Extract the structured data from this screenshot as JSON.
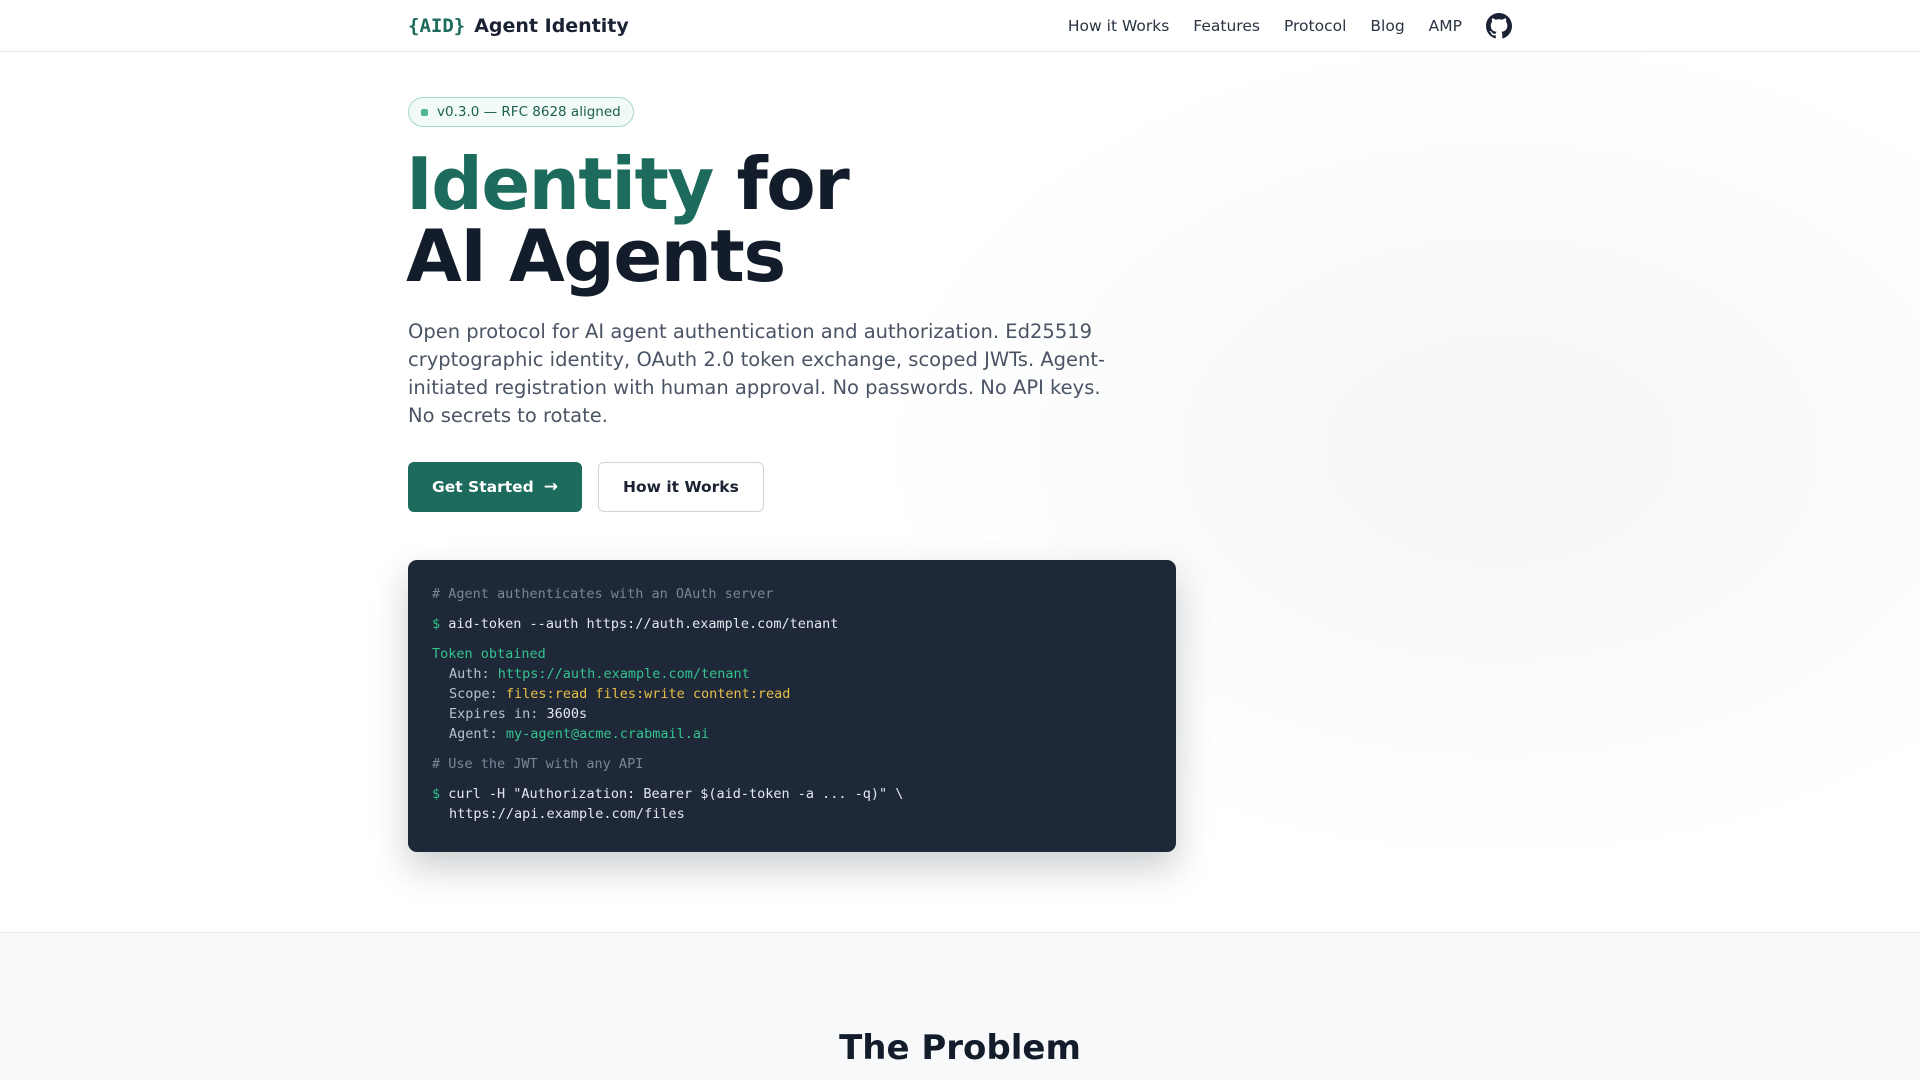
{
  "nav": {
    "brand_mark": "{AID}",
    "brand_name": "Agent Identity",
    "links": [
      "How it Works",
      "Features",
      "Protocol",
      "Blog",
      "AMP"
    ],
    "github_icon": "github-icon"
  },
  "hero": {
    "badge": "v0.3.0 — RFC 8628 aligned",
    "title_accent": "Identity",
    "title_rest_1": " for",
    "title_line_2": "AI Agents",
    "subtitle": "Open protocol for AI agent authentication and authorization. Ed25519 cryptographic identity, OAuth 2.0 token exchange, scoped JWTs. Agent-initiated registration with human approval. No passwords. No API keys. No secrets to rotate.",
    "primary_button": "Get Started",
    "primary_button_icon": "arrow-right-icon",
    "secondary_button": "How it Works"
  },
  "terminal": {
    "comment_1": "# Agent authenticates with an OAuth server",
    "prompt": "$",
    "command_1": "aid-token --auth https://auth.example.com/tenant",
    "success": "Token obtained",
    "auth_label": "Auth:",
    "auth_value": "https://auth.example.com/tenant",
    "scope_label": "Scope:",
    "scope_value": "files:read files:write content:read",
    "expires_label": "Expires in:",
    "expires_value": "3600s",
    "agent_label": "Agent:",
    "agent_value": "my-agent@acme.crabmail.ai",
    "comment_2": "# Use the JWT with any API",
    "command_2_line_1": "curl -H \"Authorization: Bearer $(aid-token -a ... -q)\" \\",
    "command_2_line_2": "https://api.example.com/files"
  },
  "problem_section": {
    "title": "The Problem"
  },
  "colors": {
    "accent": "#1c6b5c",
    "terminal_bg": "#1e2838",
    "success_green": "#33c28d",
    "scope_yellow": "#e7bf45"
  }
}
